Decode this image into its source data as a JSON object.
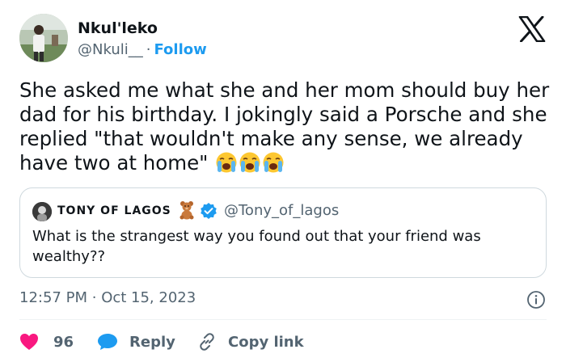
{
  "author": {
    "name": "Nkul'leko",
    "handle": "@Nkuli__",
    "separator": "·",
    "follow_label": "Follow"
  },
  "tweet": {
    "text": "She asked me what she and her mom should buy her dad for his birthday. I jokingly said a Porsche and she replied \"that wouldn't make any sense, we already have two at home\""
  },
  "quoted_tweet": {
    "name": "TONY OF LAGOS",
    "handle": "@Tony_of_lagos",
    "text": "What is the strangest way you found out that your friend was wealthy??"
  },
  "meta": {
    "time": "12:57 PM",
    "separator": "·",
    "date": "Oct 15, 2023"
  },
  "actions": {
    "likes_count": "96",
    "reply_label": "Reply",
    "copy_link_label": "Copy link"
  },
  "colors": {
    "accent": "#1d9bf0",
    "like": "#f91880",
    "text": "#0f1419",
    "secondary": "#536471",
    "border": "#cfd9de"
  },
  "icons": [
    "x-logo-icon",
    "crying-emoji-icon",
    "teddy-bear-emoji-icon",
    "verified-badge-icon",
    "info-icon",
    "heart-icon",
    "reply-bubble-icon",
    "link-icon"
  ]
}
